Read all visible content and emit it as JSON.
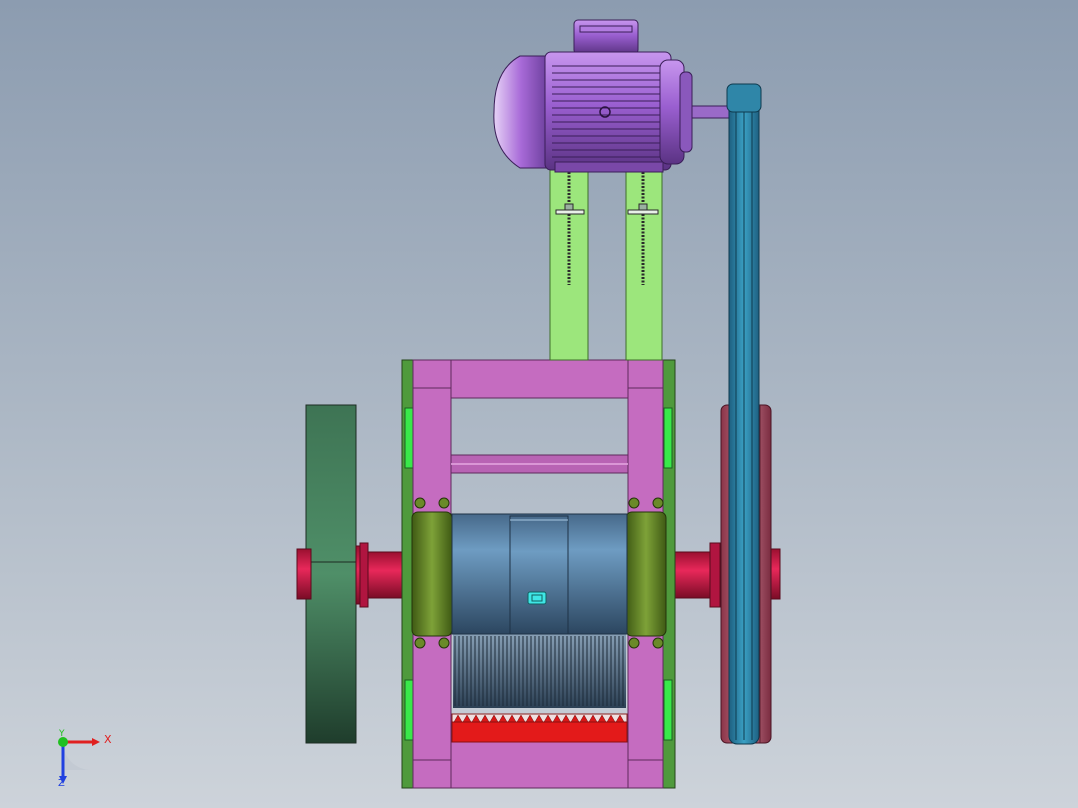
{
  "viewport": {
    "background_top": "#8c9cb0",
    "background_bottom": "#cdd3da"
  },
  "model": {
    "colors": {
      "motor": "#9a5fd0",
      "motor_dark": "#6e3f9c",
      "motor_support": "#9ce67c",
      "frame": "#c56cc0",
      "frame_side": "#5fa84a",
      "frame_window": "#39e84a",
      "flywheel": "#3f7a58",
      "shaft": "#d8194a",
      "bearing": "#5e7f22",
      "rotor": "#5c86aa",
      "sheave": "#b86478",
      "belt": "#2f86a8",
      "teeth_strip": "#e31a1a"
    }
  },
  "triad": {
    "x_label": "X",
    "y_label": "Y",
    "z_label": "Z",
    "x_color": "#e02020",
    "y_color": "#20c020",
    "z_color": "#2040e0"
  }
}
